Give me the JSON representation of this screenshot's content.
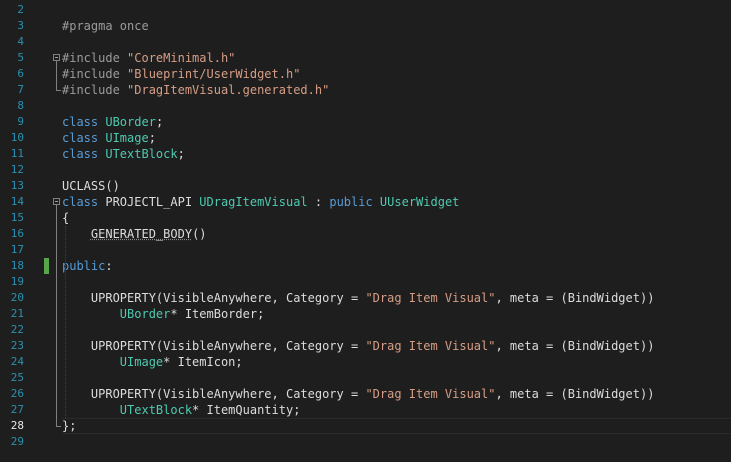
{
  "editor": {
    "current_line": "28",
    "lines": [
      {
        "num": "2",
        "tokens": []
      },
      {
        "num": "3",
        "tokens": [
          {
            "cls": "pp",
            "text": "#pragma once"
          }
        ]
      },
      {
        "num": "4",
        "tokens": []
      },
      {
        "num": "5",
        "tokens": [
          {
            "cls": "pp",
            "text": "#include "
          },
          {
            "cls": "str",
            "text": "\"CoreMinimal.h\""
          }
        ]
      },
      {
        "num": "6",
        "tokens": [
          {
            "cls": "pp",
            "text": "#include "
          },
          {
            "cls": "str",
            "text": "\"Blueprint/UserWidget.h\""
          }
        ]
      },
      {
        "num": "7",
        "tokens": [
          {
            "cls": "pp",
            "text": "#include "
          },
          {
            "cls": "str",
            "text": "\"DragItemVisual.generated.h\""
          }
        ]
      },
      {
        "num": "8",
        "tokens": []
      },
      {
        "num": "9",
        "tokens": [
          {
            "cls": "kw",
            "text": "class "
          },
          {
            "cls": "type",
            "text": "UBorder"
          },
          {
            "cls": "plain",
            "text": ";"
          }
        ]
      },
      {
        "num": "10",
        "tokens": [
          {
            "cls": "kw",
            "text": "class "
          },
          {
            "cls": "type",
            "text": "UImage"
          },
          {
            "cls": "plain",
            "text": ";"
          }
        ]
      },
      {
        "num": "11",
        "tokens": [
          {
            "cls": "kw",
            "text": "class "
          },
          {
            "cls": "type",
            "text": "UTextBlock"
          },
          {
            "cls": "plain",
            "text": ";"
          }
        ]
      },
      {
        "num": "12",
        "tokens": []
      },
      {
        "num": "13",
        "tokens": [
          {
            "cls": "plain",
            "text": "UCLASS()"
          }
        ]
      },
      {
        "num": "14",
        "tokens": [
          {
            "cls": "kw",
            "text": "class "
          },
          {
            "cls": "plain",
            "text": "PROJECTL_API "
          },
          {
            "cls": "type",
            "text": "UDragItemVisual"
          },
          {
            "cls": "plain",
            "text": " : "
          },
          {
            "cls": "kw",
            "text": "public "
          },
          {
            "cls": "type",
            "text": "UUserWidget"
          }
        ]
      },
      {
        "num": "15",
        "tokens": [
          {
            "cls": "plain",
            "text": "{"
          }
        ]
      },
      {
        "num": "16",
        "tokens": [
          {
            "cls": "plain",
            "text": "    "
          },
          {
            "cls": "plain squiggle",
            "text": "GENERATED_BODY"
          },
          {
            "cls": "plain",
            "text": "()"
          }
        ]
      },
      {
        "num": "17",
        "tokens": []
      },
      {
        "num": "18",
        "tokens": [
          {
            "cls": "kw",
            "text": "public"
          },
          {
            "cls": "plain",
            "text": ":"
          }
        ]
      },
      {
        "num": "19",
        "tokens": []
      },
      {
        "num": "20",
        "tokens": [
          {
            "cls": "plain",
            "text": "    UPROPERTY(VisibleAnywhere, Category = "
          },
          {
            "cls": "str",
            "text": "\"Drag Item Visual\""
          },
          {
            "cls": "plain",
            "text": ", meta = (BindWidget))"
          }
        ]
      },
      {
        "num": "21",
        "tokens": [
          {
            "cls": "plain",
            "text": "        "
          },
          {
            "cls": "type",
            "text": "UBorder"
          },
          {
            "cls": "plain",
            "text": "* ItemBorder;"
          }
        ]
      },
      {
        "num": "22",
        "tokens": []
      },
      {
        "num": "23",
        "tokens": [
          {
            "cls": "plain",
            "text": "    UPROPERTY(VisibleAnywhere, Category = "
          },
          {
            "cls": "str",
            "text": "\"Drag Item Visual\""
          },
          {
            "cls": "plain",
            "text": ", meta = (BindWidget))"
          }
        ]
      },
      {
        "num": "24",
        "tokens": [
          {
            "cls": "plain",
            "text": "        "
          },
          {
            "cls": "type",
            "text": "UImage"
          },
          {
            "cls": "plain",
            "text": "* ItemIcon;"
          }
        ]
      },
      {
        "num": "25",
        "tokens": []
      },
      {
        "num": "26",
        "tokens": [
          {
            "cls": "plain",
            "text": "    UPROPERTY(VisibleAnywhere, Category = "
          },
          {
            "cls": "str",
            "text": "\"Drag Item Visual\""
          },
          {
            "cls": "plain",
            "text": ", meta = (BindWidget))"
          }
        ]
      },
      {
        "num": "27",
        "tokens": [
          {
            "cls": "plain",
            "text": "        "
          },
          {
            "cls": "type",
            "text": "UTextBlock"
          },
          {
            "cls": "plain",
            "text": "* ItemQuantity;"
          }
        ]
      },
      {
        "num": "28",
        "tokens": [
          {
            "cls": "plain",
            "text": "};"
          }
        ]
      },
      {
        "num": "29",
        "tokens": []
      }
    ]
  },
  "colors": {
    "background": "#1e1e1e",
    "keyword": "#569cd6",
    "type": "#4ec9b0",
    "string": "#d69d85",
    "preprocessor": "#9b9b9b",
    "line_number": "#2b91af",
    "change_marker": "#57a64a"
  }
}
